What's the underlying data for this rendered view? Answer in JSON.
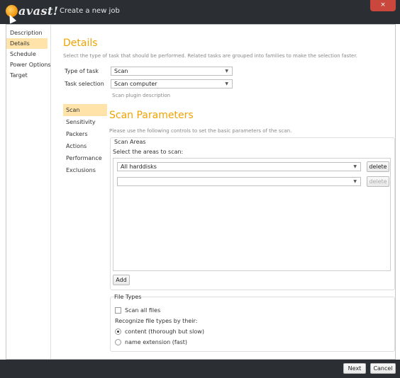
{
  "titlebar": {
    "logo_text": "avast!",
    "title": "Create a new job",
    "close_glyph": "×"
  },
  "nav": {
    "items": [
      {
        "label": "Description"
      },
      {
        "label": "Details"
      },
      {
        "label": "Schedule"
      },
      {
        "label": "Power Options"
      },
      {
        "label": "Target"
      }
    ]
  },
  "details": {
    "title": "Details",
    "description": "Select the type of task that should be performed. Related tasks are grouped into families to make the selection faster.",
    "type_of_task_label": "Type of task",
    "type_of_task_value": "Scan",
    "task_selection_label": "Task selection",
    "task_selection_value": "Scan computer",
    "plugin_description": "Scan plugin description"
  },
  "subnav": {
    "items": [
      {
        "label": "Scan"
      },
      {
        "label": "Sensitivity"
      },
      {
        "label": "Packers"
      },
      {
        "label": "Actions"
      },
      {
        "label": "Performance"
      },
      {
        "label": "Exclusions"
      }
    ]
  },
  "scan": {
    "title": "Scan Parameters",
    "description": "Please use the following controls to set the basic parameters of the scan.",
    "areas_group_title": "Scan Areas",
    "areas_prompt": "Select the areas to scan:",
    "area_rows": [
      {
        "value": "All harddisks",
        "delete_label": "delete"
      },
      {
        "value": "",
        "delete_label": "delete"
      }
    ],
    "add_label": "Add",
    "file_types_title": "File Types",
    "scan_all_files_label": "Scan all files",
    "recognize_label": "Recognize file types by their:",
    "option_content": "content (thorough but slow)",
    "option_extension": "name extension (fast)"
  },
  "footer": {
    "next_label": "Next",
    "cancel_label": "Cancel"
  },
  "colors": {
    "accent": "#f0a300",
    "highlight": "#ffe3a8",
    "chrome": "#2b2e33"
  }
}
